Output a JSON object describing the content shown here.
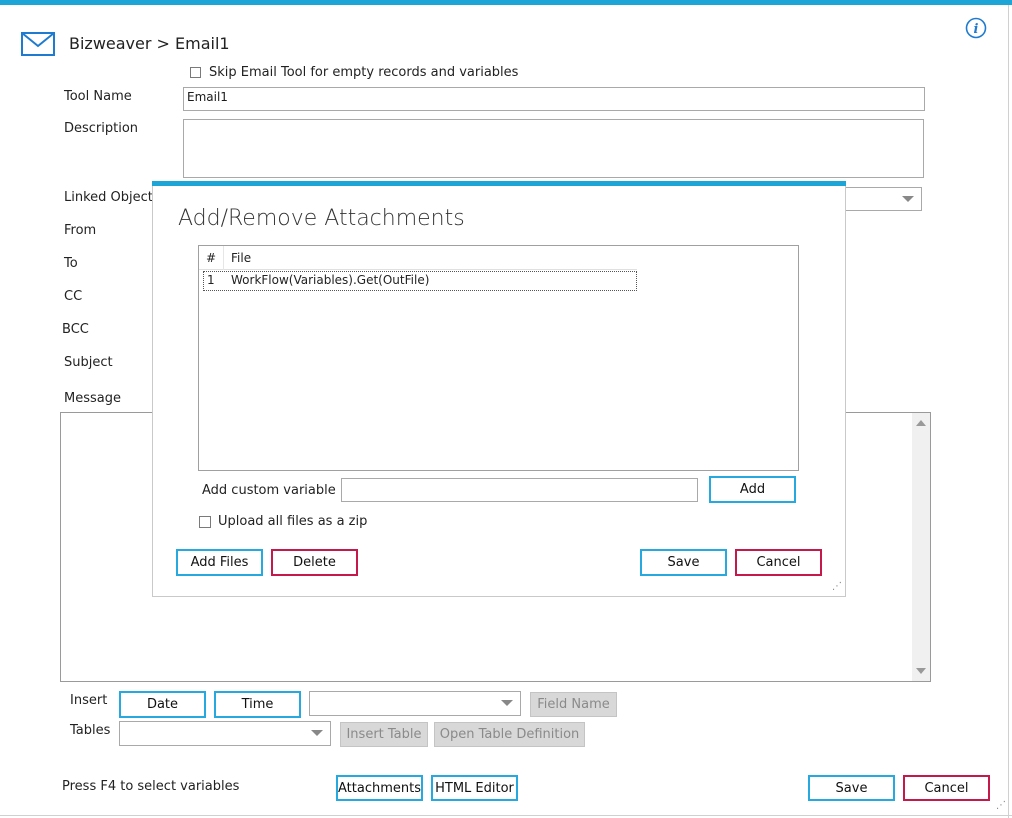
{
  "header": {
    "breadcrumb": "Bizweaver > Email1",
    "mail_icon": "mail-icon",
    "info_icon": "info-icon"
  },
  "form": {
    "skip_label": "Skip Email Tool for empty records and variables",
    "tool_name_label": "Tool Name",
    "tool_name_value": "Email1",
    "description_label": "Description",
    "description_value": "",
    "linked_object_label": "Linked Object",
    "from_label": "From",
    "to_label": "To",
    "cc_label": "CC",
    "bcc_label": "BCC",
    "subject_label": "Subject",
    "message_label": "Message"
  },
  "insert": {
    "insert_label": "Insert",
    "date_button": "Date",
    "time_button": "Time",
    "field_name_button": "Field Name",
    "tables_label": "Tables",
    "insert_table_button": "Insert Table",
    "open_table_def_button": "Open Table Definition"
  },
  "footer": {
    "hint": "Press F4 to select variables",
    "attachments_button": "Attachments",
    "html_editor_button": "HTML Editor",
    "save_button": "Save",
    "cancel_button": "Cancel"
  },
  "dialog": {
    "title": "Add/Remove Attachments",
    "columns": [
      "#",
      "File"
    ],
    "rows": [
      {
        "num": "1",
        "file": "WorkFlow(Variables).Get(OutFile)"
      }
    ],
    "custom_var_label": "Add custom variable",
    "custom_var_value": "",
    "add_button": "Add",
    "zip_label": "Upload all files as a zip",
    "add_files_button": "Add Files",
    "delete_button": "Delete",
    "save_button": "Save",
    "cancel_button": "Cancel"
  },
  "colors": {
    "accent": "#1ea5d8",
    "cancel_border": "#c4194a"
  }
}
